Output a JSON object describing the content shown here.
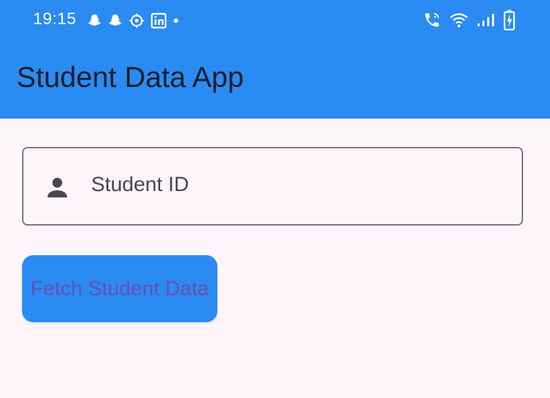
{
  "status_bar": {
    "time": "19:15",
    "left_icons": [
      "snapchat-icon",
      "snapchat-icon",
      "settings-icon",
      "linkedin-icon",
      "dot-icon"
    ],
    "right_icons": [
      "wifi-calling-icon",
      "wifi-icon",
      "signal-icon",
      "battery-charging-icon"
    ]
  },
  "app_bar": {
    "title": "Student Data App",
    "color": "#2A8BF2"
  },
  "form": {
    "student_id_placeholder": "Student ID",
    "input_icon": "person-icon"
  },
  "actions": {
    "fetch_label": "Fetch Student Data",
    "button_color": "#2A8BF2"
  },
  "theme": {
    "background": "#FCF6FB",
    "label_color": "#6A4FB0"
  }
}
